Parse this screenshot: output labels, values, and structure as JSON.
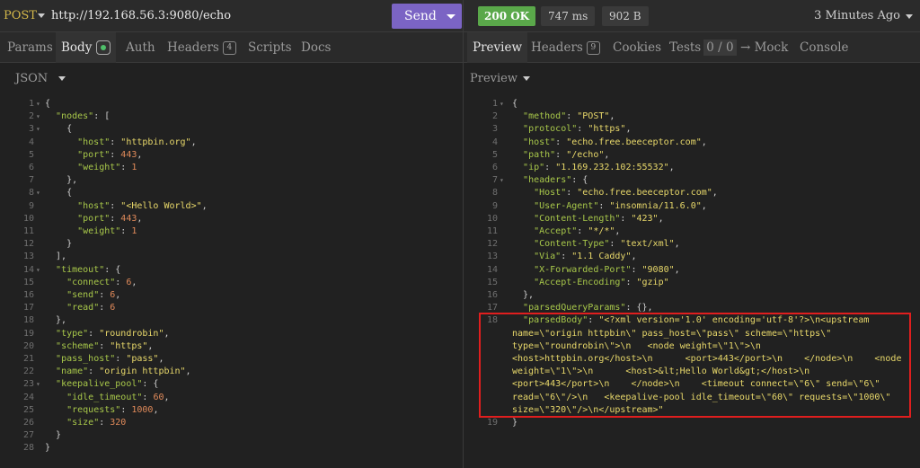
{
  "request": {
    "method": "POST",
    "url": "http://192.168.56.3:9080/echo",
    "send_label": "Send",
    "tabs": {
      "params": "Params",
      "body": "Body",
      "auth": "Auth",
      "headers": "Headers",
      "headers_count": "4",
      "scripts": "Scripts",
      "docs": "Docs"
    },
    "body_format": "JSON",
    "body_lines": [
      [
        [
          "p",
          "{"
        ]
      ],
      [
        [
          "p",
          "  "
        ],
        [
          "k",
          "\"nodes\""
        ],
        [
          "p",
          ": ["
        ]
      ],
      [
        [
          "p",
          "    {"
        ]
      ],
      [
        [
          "p",
          "      "
        ],
        [
          "k",
          "\"host\""
        ],
        [
          "p",
          ": "
        ],
        [
          "s",
          "\"httpbin.org\""
        ],
        [
          "p",
          ","
        ]
      ],
      [
        [
          "p",
          "      "
        ],
        [
          "k",
          "\"port\""
        ],
        [
          "p",
          ": "
        ],
        [
          "n",
          "443"
        ],
        [
          "p",
          ","
        ]
      ],
      [
        [
          "p",
          "      "
        ],
        [
          "k",
          "\"weight\""
        ],
        [
          "p",
          ": "
        ],
        [
          "n",
          "1"
        ]
      ],
      [
        [
          "p",
          "    },"
        ]
      ],
      [
        [
          "p",
          "    {"
        ]
      ],
      [
        [
          "p",
          "      "
        ],
        [
          "k",
          "\"host\""
        ],
        [
          "p",
          ": "
        ],
        [
          "s",
          "\"<Hello World>\""
        ],
        [
          "p",
          ","
        ]
      ],
      [
        [
          "p",
          "      "
        ],
        [
          "k",
          "\"port\""
        ],
        [
          "p",
          ": "
        ],
        [
          "n",
          "443"
        ],
        [
          "p",
          ","
        ]
      ],
      [
        [
          "p",
          "      "
        ],
        [
          "k",
          "\"weight\""
        ],
        [
          "p",
          ": "
        ],
        [
          "n",
          "1"
        ]
      ],
      [
        [
          "p",
          "    }"
        ]
      ],
      [
        [
          "p",
          "  ],"
        ]
      ],
      [
        [
          "p",
          "  "
        ],
        [
          "k",
          "\"timeout\""
        ],
        [
          "p",
          ": {"
        ]
      ],
      [
        [
          "p",
          "    "
        ],
        [
          "k",
          "\"connect\""
        ],
        [
          "p",
          ": "
        ],
        [
          "n",
          "6"
        ],
        [
          "p",
          ","
        ]
      ],
      [
        [
          "p",
          "    "
        ],
        [
          "k",
          "\"send\""
        ],
        [
          "p",
          ": "
        ],
        [
          "n",
          "6"
        ],
        [
          "p",
          ","
        ]
      ],
      [
        [
          "p",
          "    "
        ],
        [
          "k",
          "\"read\""
        ],
        [
          "p",
          ": "
        ],
        [
          "n",
          "6"
        ]
      ],
      [
        [
          "p",
          "  },"
        ]
      ],
      [
        [
          "p",
          "  "
        ],
        [
          "k",
          "\"type\""
        ],
        [
          "p",
          ": "
        ],
        [
          "s",
          "\"roundrobin\""
        ],
        [
          "p",
          ","
        ]
      ],
      [
        [
          "p",
          "  "
        ],
        [
          "k",
          "\"scheme\""
        ],
        [
          "p",
          ": "
        ],
        [
          "s",
          "\"https\""
        ],
        [
          "p",
          ","
        ]
      ],
      [
        [
          "p",
          "  "
        ],
        [
          "k",
          "\"pass_host\""
        ],
        [
          "p",
          ": "
        ],
        [
          "s",
          "\"pass\""
        ],
        [
          "p",
          ","
        ]
      ],
      [
        [
          "p",
          "  "
        ],
        [
          "k",
          "\"name\""
        ],
        [
          "p",
          ": "
        ],
        [
          "s",
          "\"origin httpbin\""
        ],
        [
          "p",
          ","
        ]
      ],
      [
        [
          "p",
          "  "
        ],
        [
          "k",
          "\"keepalive_pool\""
        ],
        [
          "p",
          ": {"
        ]
      ],
      [
        [
          "p",
          "    "
        ],
        [
          "k",
          "\"idle_timeout\""
        ],
        [
          "p",
          ": "
        ],
        [
          "n",
          "60"
        ],
        [
          "p",
          ","
        ]
      ],
      [
        [
          "p",
          "    "
        ],
        [
          "k",
          "\"requests\""
        ],
        [
          "p",
          ": "
        ],
        [
          "n",
          "1000"
        ],
        [
          "p",
          ","
        ]
      ],
      [
        [
          "p",
          "    "
        ],
        [
          "k",
          "\"size\""
        ],
        [
          "p",
          ": "
        ],
        [
          "n",
          "320"
        ]
      ],
      [
        [
          "p",
          "  }"
        ]
      ],
      [
        [
          "p",
          "}"
        ]
      ]
    ],
    "folds": [
      1,
      2,
      3,
      8,
      14,
      23
    ]
  },
  "response": {
    "status": "200 OK",
    "time": "747 ms",
    "size": "902 B",
    "ago": "3 Minutes Ago",
    "tabs": {
      "preview": "Preview",
      "headers": "Headers",
      "headers_count": "9",
      "cookies": "Cookies",
      "tests": "Tests",
      "tests_count": "0 / 0",
      "mock": "→ Mock",
      "console": "Console"
    },
    "preview_mode": "Preview",
    "lines": [
      {
        "n": "1",
        "t": [
          [
            "p",
            "{"
          ]
        ]
      },
      {
        "n": "2",
        "t": [
          [
            "p",
            "  "
          ],
          [
            "k",
            "\"method\""
          ],
          [
            "p",
            ": "
          ],
          [
            "s",
            "\"POST\""
          ],
          [
            "p",
            ","
          ]
        ]
      },
      {
        "n": "3",
        "t": [
          [
            "p",
            "  "
          ],
          [
            "k",
            "\"protocol\""
          ],
          [
            "p",
            ": "
          ],
          [
            "s",
            "\"https\""
          ],
          [
            "p",
            ","
          ]
        ]
      },
      {
        "n": "4",
        "t": [
          [
            "p",
            "  "
          ],
          [
            "k",
            "\"host\""
          ],
          [
            "p",
            ": "
          ],
          [
            "s",
            "\"echo.free.beeceptor.com\""
          ],
          [
            "p",
            ","
          ]
        ]
      },
      {
        "n": "5",
        "t": [
          [
            "p",
            "  "
          ],
          [
            "k",
            "\"path\""
          ],
          [
            "p",
            ": "
          ],
          [
            "s",
            "\"/echo\""
          ],
          [
            "p",
            ","
          ]
        ]
      },
      {
        "n": "6",
        "t": [
          [
            "p",
            "  "
          ],
          [
            "k",
            "\"ip\""
          ],
          [
            "p",
            ": "
          ],
          [
            "s",
            "\"1.169.232.102:55532\""
          ],
          [
            "p",
            ","
          ]
        ]
      },
      {
        "n": "7",
        "t": [
          [
            "p",
            "  "
          ],
          [
            "k",
            "\"headers\""
          ],
          [
            "p",
            ": {"
          ]
        ]
      },
      {
        "n": "8",
        "t": [
          [
            "p",
            "    "
          ],
          [
            "k",
            "\"Host\""
          ],
          [
            "p",
            ": "
          ],
          [
            "s",
            "\"echo.free.beeceptor.com\""
          ],
          [
            "p",
            ","
          ]
        ]
      },
      {
        "n": "9",
        "t": [
          [
            "p",
            "    "
          ],
          [
            "k",
            "\"User-Agent\""
          ],
          [
            "p",
            ": "
          ],
          [
            "s",
            "\"insomnia/11.6.0\""
          ],
          [
            "p",
            ","
          ]
        ]
      },
      {
        "n": "10",
        "t": [
          [
            "p",
            "    "
          ],
          [
            "k",
            "\"Content-Length\""
          ],
          [
            "p",
            ": "
          ],
          [
            "s",
            "\"423\""
          ],
          [
            "p",
            ","
          ]
        ]
      },
      {
        "n": "11",
        "t": [
          [
            "p",
            "    "
          ],
          [
            "k",
            "\"Accept\""
          ],
          [
            "p",
            ": "
          ],
          [
            "s",
            "\"*/*\""
          ],
          [
            "p",
            ","
          ]
        ]
      },
      {
        "n": "12",
        "t": [
          [
            "p",
            "    "
          ],
          [
            "k",
            "\"Content-Type\""
          ],
          [
            "p",
            ": "
          ],
          [
            "s",
            "\"text/xml\""
          ],
          [
            "p",
            ","
          ]
        ]
      },
      {
        "n": "13",
        "t": [
          [
            "p",
            "    "
          ],
          [
            "k",
            "\"Via\""
          ],
          [
            "p",
            ": "
          ],
          [
            "s",
            "\"1.1 Caddy\""
          ],
          [
            "p",
            ","
          ]
        ]
      },
      {
        "n": "14",
        "t": [
          [
            "p",
            "    "
          ],
          [
            "k",
            "\"X-Forwarded-Port\""
          ],
          [
            "p",
            ": "
          ],
          [
            "s",
            "\"9080\""
          ],
          [
            "p",
            ","
          ]
        ]
      },
      {
        "n": "15",
        "t": [
          [
            "p",
            "    "
          ],
          [
            "k",
            "\"Accept-Encoding\""
          ],
          [
            "p",
            ": "
          ],
          [
            "s",
            "\"gzip\""
          ]
        ]
      },
      {
        "n": "16",
        "t": [
          [
            "p",
            "  },"
          ]
        ]
      },
      {
        "n": "17",
        "t": [
          [
            "p",
            "  "
          ],
          [
            "k",
            "\"parsedQueryParams\""
          ],
          [
            "p",
            ": {},"
          ]
        ]
      },
      {
        "n": "18",
        "t": [
          [
            "p",
            "  "
          ],
          [
            "k",
            "\"parsedBody\""
          ],
          [
            "p",
            ": "
          ],
          [
            "s",
            "\"<?xml version='1.0' encoding='utf-8'?>\\n<upstream"
          ]
        ]
      },
      {
        "n": "",
        "t": [
          [
            "s",
            "name=\\\"origin httpbin\\\" pass_host=\\\"pass\\\" scheme=\\\"https\\\""
          ]
        ]
      },
      {
        "n": "",
        "t": [
          [
            "s",
            "type=\\\"roundrobin\\\">\\n   <node weight=\\\"1\\\">\\n"
          ]
        ]
      },
      {
        "n": "",
        "t": [
          [
            "s",
            "<host>httpbin.org</host>\\n      <port>443</port>\\n    </node>\\n    <node"
          ]
        ]
      },
      {
        "n": "",
        "t": [
          [
            "s",
            "weight=\\\"1\\\">\\n      <host>&lt;Hello World&gt;</host>\\n"
          ]
        ]
      },
      {
        "n": "",
        "t": [
          [
            "s",
            "<port>443</port>\\n    </node>\\n    <timeout connect=\\\"6\\\" send=\\\"6\\\""
          ]
        ]
      },
      {
        "n": "",
        "t": [
          [
            "s",
            "read=\\\"6\\\"/>\\n   <keepalive-pool idle_timeout=\\\"60\\\" requests=\\\"1000\\\""
          ]
        ]
      },
      {
        "n": "",
        "t": [
          [
            "s",
            "size=\\\"320\\\"/>\\n</upstream>\""
          ]
        ]
      },
      {
        "n": "19",
        "t": [
          [
            "p",
            "}"
          ]
        ]
      }
    ],
    "folds": [
      1,
      7
    ]
  },
  "colors": {
    "send": "#7b64c4",
    "status_ok": "#5aa84a",
    "key": "#a8c84a",
    "string": "#e8d86a",
    "number": "#e08a5a",
    "highlight_box": "#e01e1e"
  }
}
